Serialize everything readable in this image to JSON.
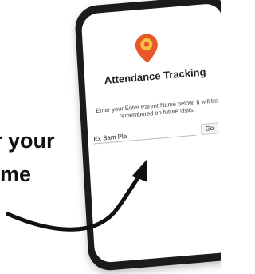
{
  "side_text": {
    "line1": "r your",
    "line2": "me"
  },
  "app": {
    "title": "Attendance Tracking",
    "instructions": "Enter your Enter Parent Name below. It will be remembered on future visits.",
    "name_input": {
      "value": "Ex Sam Ple",
      "placeholder": ""
    },
    "go_label": "Go"
  },
  "icons": {
    "logo": "location-pin-icon",
    "arrow": "curved-arrow-icon"
  },
  "colors": {
    "pin_outer": "#e8572a",
    "pin_inner": "#f5c242",
    "phone_frame": "#1b1b1e",
    "screen": "#ffffff",
    "arrow": "#111111"
  }
}
